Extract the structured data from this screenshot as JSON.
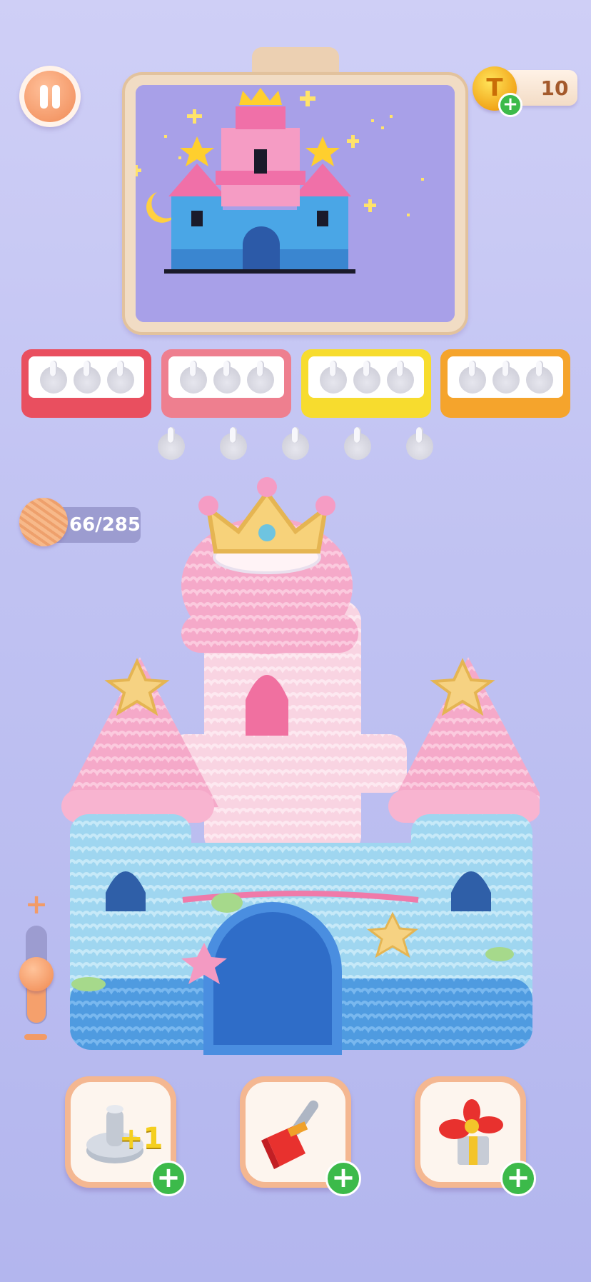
{
  "hud": {
    "coins": "10",
    "yarn_progress": "66/285",
    "coin_symbol": "T"
  },
  "spool_trays": [
    {
      "color": "#e94f5f",
      "light": "#ffd0d6"
    },
    {
      "color": "#ee7f8f",
      "light": "#ffd6de"
    },
    {
      "color": "#f7dc2e",
      "light": "#fff6b0"
    },
    {
      "color": "#f5a42c",
      "light": "#ffe1a6"
    }
  ],
  "loose_pegs": 5,
  "zoom": {
    "plus": "+",
    "level": 0.45
  },
  "boosters": [
    {
      "name": "extra-peg",
      "label": "+1"
    },
    {
      "name": "brush"
    },
    {
      "name": "propeller"
    }
  ],
  "colors": {
    "accent": "#f29b67",
    "green": "#3cba4a",
    "bg": "#c0c2f2"
  }
}
